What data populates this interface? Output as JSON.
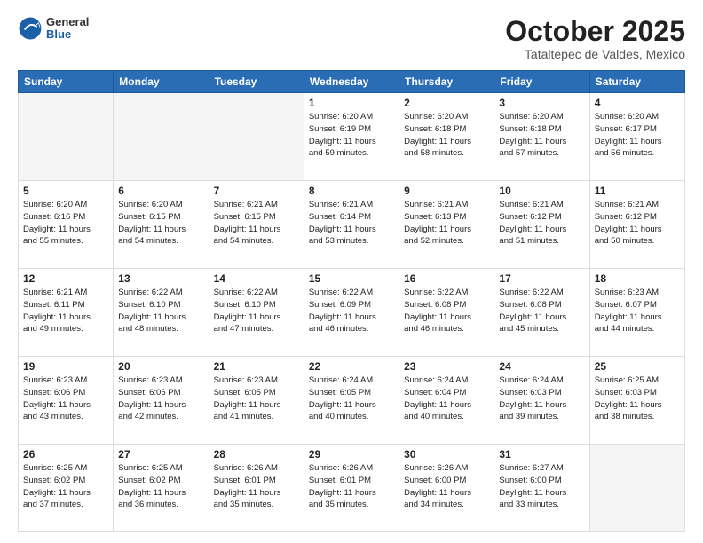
{
  "header": {
    "logo_general": "General",
    "logo_blue": "Blue",
    "month_title": "October 2025",
    "location": "Tataltepec de Valdes, Mexico"
  },
  "weekdays": [
    "Sunday",
    "Monday",
    "Tuesday",
    "Wednesday",
    "Thursday",
    "Friday",
    "Saturday"
  ],
  "weeks": [
    [
      {
        "day": "",
        "info": ""
      },
      {
        "day": "",
        "info": ""
      },
      {
        "day": "",
        "info": ""
      },
      {
        "day": "1",
        "info": "Sunrise: 6:20 AM\nSunset: 6:19 PM\nDaylight: 11 hours\nand 59 minutes."
      },
      {
        "day": "2",
        "info": "Sunrise: 6:20 AM\nSunset: 6:18 PM\nDaylight: 11 hours\nand 58 minutes."
      },
      {
        "day": "3",
        "info": "Sunrise: 6:20 AM\nSunset: 6:18 PM\nDaylight: 11 hours\nand 57 minutes."
      },
      {
        "day": "4",
        "info": "Sunrise: 6:20 AM\nSunset: 6:17 PM\nDaylight: 11 hours\nand 56 minutes."
      }
    ],
    [
      {
        "day": "5",
        "info": "Sunrise: 6:20 AM\nSunset: 6:16 PM\nDaylight: 11 hours\nand 55 minutes."
      },
      {
        "day": "6",
        "info": "Sunrise: 6:20 AM\nSunset: 6:15 PM\nDaylight: 11 hours\nand 54 minutes."
      },
      {
        "day": "7",
        "info": "Sunrise: 6:21 AM\nSunset: 6:15 PM\nDaylight: 11 hours\nand 54 minutes."
      },
      {
        "day": "8",
        "info": "Sunrise: 6:21 AM\nSunset: 6:14 PM\nDaylight: 11 hours\nand 53 minutes."
      },
      {
        "day": "9",
        "info": "Sunrise: 6:21 AM\nSunset: 6:13 PM\nDaylight: 11 hours\nand 52 minutes."
      },
      {
        "day": "10",
        "info": "Sunrise: 6:21 AM\nSunset: 6:12 PM\nDaylight: 11 hours\nand 51 minutes."
      },
      {
        "day": "11",
        "info": "Sunrise: 6:21 AM\nSunset: 6:12 PM\nDaylight: 11 hours\nand 50 minutes."
      }
    ],
    [
      {
        "day": "12",
        "info": "Sunrise: 6:21 AM\nSunset: 6:11 PM\nDaylight: 11 hours\nand 49 minutes."
      },
      {
        "day": "13",
        "info": "Sunrise: 6:22 AM\nSunset: 6:10 PM\nDaylight: 11 hours\nand 48 minutes."
      },
      {
        "day": "14",
        "info": "Sunrise: 6:22 AM\nSunset: 6:10 PM\nDaylight: 11 hours\nand 47 minutes."
      },
      {
        "day": "15",
        "info": "Sunrise: 6:22 AM\nSunset: 6:09 PM\nDaylight: 11 hours\nand 46 minutes."
      },
      {
        "day": "16",
        "info": "Sunrise: 6:22 AM\nSunset: 6:08 PM\nDaylight: 11 hours\nand 46 minutes."
      },
      {
        "day": "17",
        "info": "Sunrise: 6:22 AM\nSunset: 6:08 PM\nDaylight: 11 hours\nand 45 minutes."
      },
      {
        "day": "18",
        "info": "Sunrise: 6:23 AM\nSunset: 6:07 PM\nDaylight: 11 hours\nand 44 minutes."
      }
    ],
    [
      {
        "day": "19",
        "info": "Sunrise: 6:23 AM\nSunset: 6:06 PM\nDaylight: 11 hours\nand 43 minutes."
      },
      {
        "day": "20",
        "info": "Sunrise: 6:23 AM\nSunset: 6:06 PM\nDaylight: 11 hours\nand 42 minutes."
      },
      {
        "day": "21",
        "info": "Sunrise: 6:23 AM\nSunset: 6:05 PM\nDaylight: 11 hours\nand 41 minutes."
      },
      {
        "day": "22",
        "info": "Sunrise: 6:24 AM\nSunset: 6:05 PM\nDaylight: 11 hours\nand 40 minutes."
      },
      {
        "day": "23",
        "info": "Sunrise: 6:24 AM\nSunset: 6:04 PM\nDaylight: 11 hours\nand 40 minutes."
      },
      {
        "day": "24",
        "info": "Sunrise: 6:24 AM\nSunset: 6:03 PM\nDaylight: 11 hours\nand 39 minutes."
      },
      {
        "day": "25",
        "info": "Sunrise: 6:25 AM\nSunset: 6:03 PM\nDaylight: 11 hours\nand 38 minutes."
      }
    ],
    [
      {
        "day": "26",
        "info": "Sunrise: 6:25 AM\nSunset: 6:02 PM\nDaylight: 11 hours\nand 37 minutes."
      },
      {
        "day": "27",
        "info": "Sunrise: 6:25 AM\nSunset: 6:02 PM\nDaylight: 11 hours\nand 36 minutes."
      },
      {
        "day": "28",
        "info": "Sunrise: 6:26 AM\nSunset: 6:01 PM\nDaylight: 11 hours\nand 35 minutes."
      },
      {
        "day": "29",
        "info": "Sunrise: 6:26 AM\nSunset: 6:01 PM\nDaylight: 11 hours\nand 35 minutes."
      },
      {
        "day": "30",
        "info": "Sunrise: 6:26 AM\nSunset: 6:00 PM\nDaylight: 11 hours\nand 34 minutes."
      },
      {
        "day": "31",
        "info": "Sunrise: 6:27 AM\nSunset: 6:00 PM\nDaylight: 11 hours\nand 33 minutes."
      },
      {
        "day": "",
        "info": ""
      }
    ]
  ]
}
